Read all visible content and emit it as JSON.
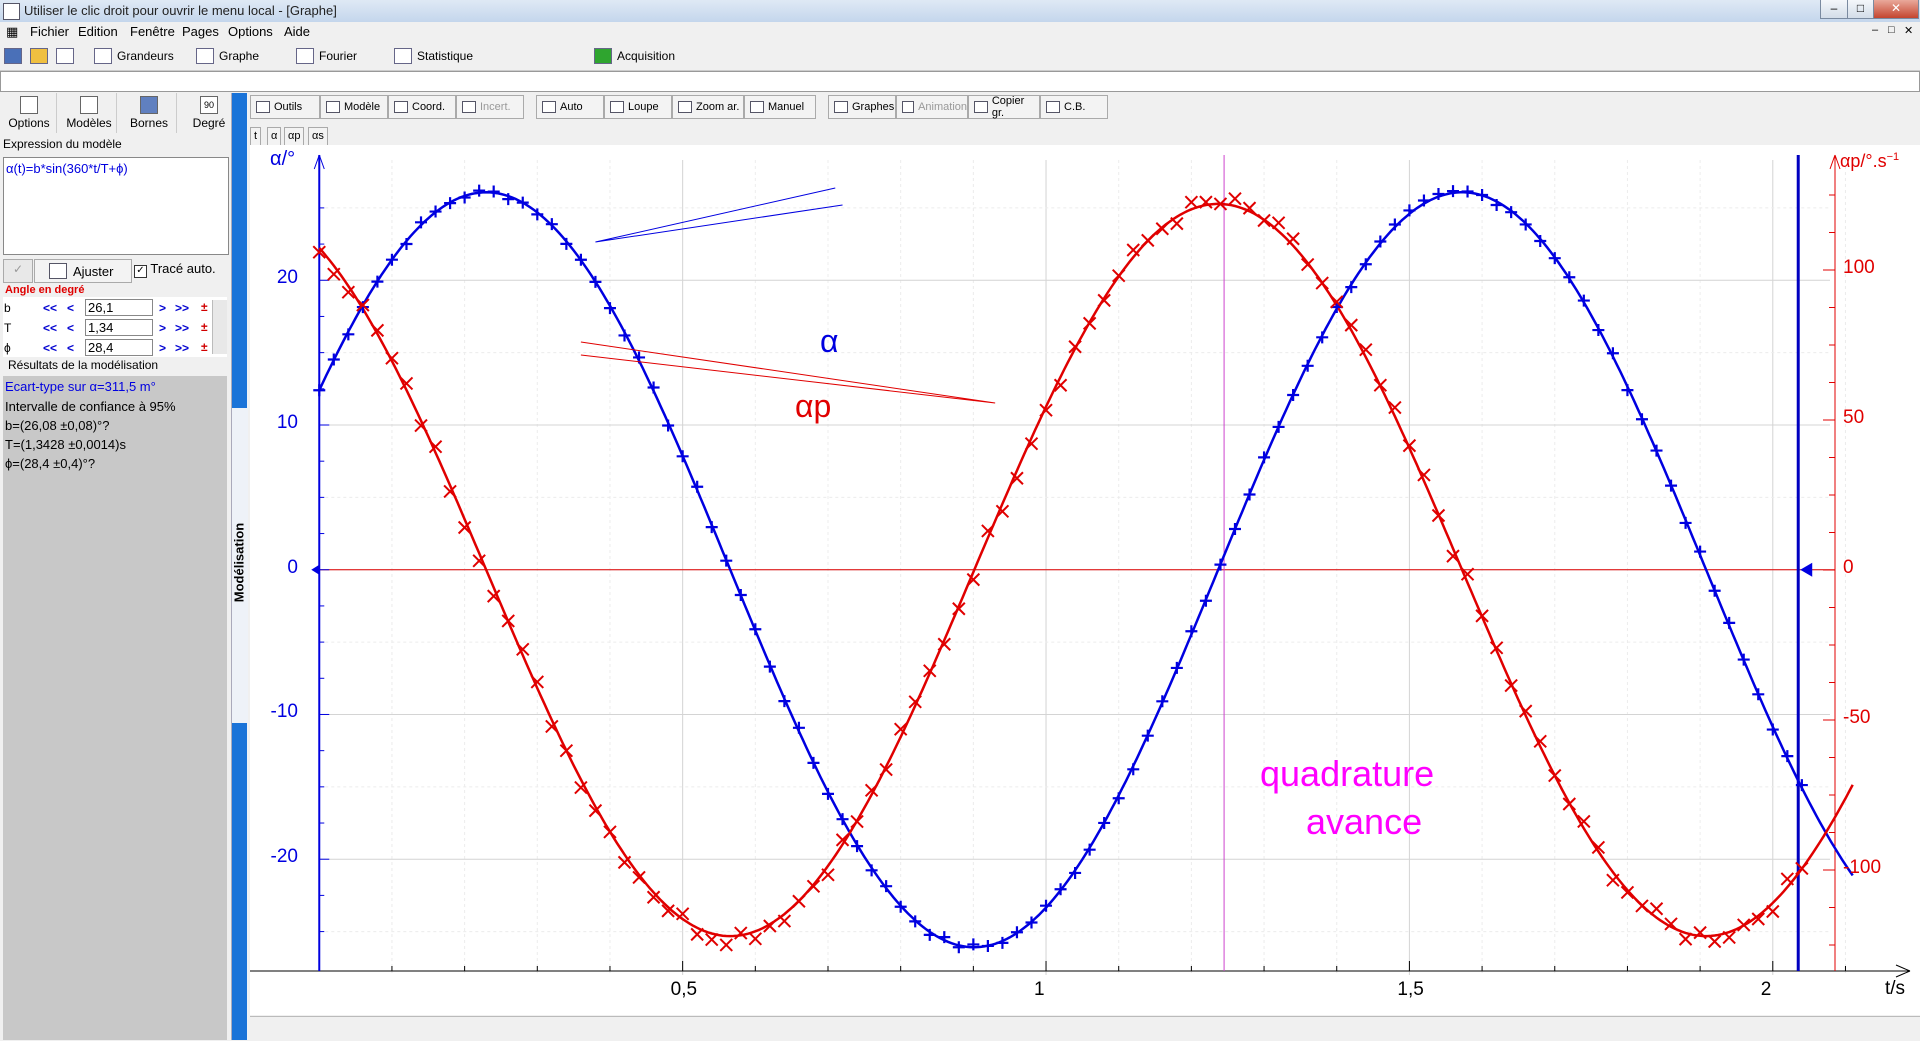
{
  "window": {
    "title": "Utiliser le clic droit pour ouvrir le menu local - [Graphe]"
  },
  "menu": [
    {
      "label": "Fichier"
    },
    {
      "label": "Edition"
    },
    {
      "label": "Fenêtre"
    },
    {
      "label": "Pages"
    },
    {
      "label": "Options"
    },
    {
      "label": "Aide"
    }
  ],
  "toolbar": {
    "grandeurs": "Grandeurs",
    "graphe": "Graphe",
    "fourier": "Fourier",
    "statistique": "Statistique",
    "acquisition": "Acquisition"
  },
  "left_panel": {
    "buttons": [
      "Options",
      "Modèles",
      "Bornes",
      "Degré"
    ],
    "degree_badge": "90",
    "expression_title": "Expression du modèle",
    "expression": "α(t)=b*sin(360*t/T+ϕ)",
    "ajuster": "Ajuster",
    "trace_auto": "Tracé auto.",
    "angle_unit": "Angle en degré",
    "params": [
      {
        "name": "b",
        "value": "26,1"
      },
      {
        "name": "T",
        "value": "1,34"
      },
      {
        "name": "ϕ",
        "value": "28,4"
      }
    ],
    "nav": {
      "first": "<<",
      "prev": "<",
      "next": ">",
      "last": ">>",
      "pm": "±"
    },
    "results_title": "Résultats de la modélisation",
    "results": [
      "Ecart-type sur α=311,5 m°",
      "Intervalle de confiance à 95%",
      "b=(26,08 ±0,08)°?",
      "T=(1,3428 ±0,0014)s",
      "ϕ=(28,4 ±0,4)°?"
    ],
    "side_label": "Modélisation"
  },
  "graph_toolbar": [
    {
      "label": "Outils",
      "enabled": true
    },
    {
      "label": "Modèle",
      "enabled": true
    },
    {
      "label": "Coord.",
      "enabled": true
    },
    {
      "label": "Incert.",
      "enabled": false
    },
    {
      "label": "Auto",
      "enabled": true
    },
    {
      "label": "Loupe",
      "enabled": true
    },
    {
      "label": "Zoom ar.",
      "enabled": true
    },
    {
      "label": "Manuel",
      "enabled": true
    },
    {
      "label": "Graphes",
      "enabled": true
    },
    {
      "label": "Animation",
      "enabled": false
    },
    {
      "label": "Copier gr.",
      "enabled": true
    },
    {
      "label": "C.B.",
      "enabled": true
    }
  ],
  "curve_tabs": [
    "t",
    "α",
    "αp",
    "αs"
  ],
  "plot": {
    "left_axis_title": "α/°",
    "right_axis_title": "αp/°.s",
    "right_axis_exp": "−1",
    "x_axis_title": "t/s",
    "left_ticks": [
      "20",
      "10",
      "0",
      "-10",
      "-20"
    ],
    "right_ticks": [
      "100",
      "50",
      "0",
      "-50",
      "-100"
    ],
    "x_ticks": [
      "0,5",
      "1",
      "1,5",
      "2"
    ],
    "annotation_alpha": "α",
    "annotation_alphap": "αp",
    "annotation_quad1": "quadrature",
    "annotation_quad2": "avance",
    "colors": {
      "alpha": "#0000e0",
      "alphap": "#e00000",
      "annotation": "#ff00ff",
      "grid": "#d8d8d8"
    }
  },
  "chart_data": {
    "type": "scatter",
    "x_label": "t/s",
    "y_label": "α/°",
    "y2_label": "αp/°.s−1",
    "xlim": [
      -0.01,
      2.12
    ],
    "ylim": [
      -28,
      29
    ],
    "y2lim": [
      -135,
      140
    ],
    "x_ticks": [
      0.5,
      1,
      1.5,
      2
    ],
    "y_ticks": [
      -20,
      -10,
      0,
      10,
      20
    ],
    "y2_ticks": [
      -100,
      -50,
      0,
      50,
      100
    ],
    "model": {
      "expression": "α(t)=b*sin(360*t/T+ϕ)",
      "b": 26.08,
      "T": 1.3428,
      "phi": 28.4
    },
    "vertical_markers": [
      1.245,
      2.035
    ],
    "series": [
      {
        "name": "α",
        "axis": "left",
        "marker": "+",
        "t_start": 0.0,
        "t_end": 2.04,
        "dt": 0.02
      },
      {
        "name": "αp",
        "axis": "right",
        "marker": "x",
        "t_start": 0.0,
        "t_end": 2.04,
        "dt": 0.02
      }
    ]
  }
}
